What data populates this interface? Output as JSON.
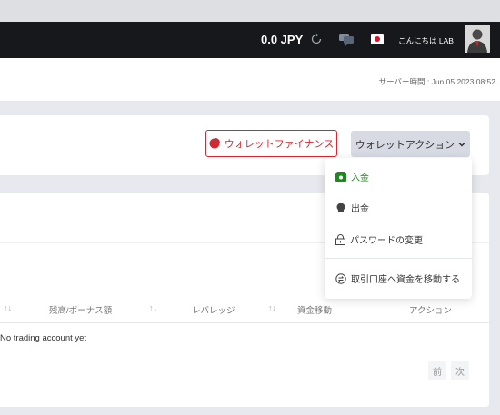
{
  "header": {
    "balance": "0.0 JPY",
    "greeting": "こんにちは LAB"
  },
  "server_time": "サーバー時間 : Jun 05 2023 08:52",
  "actions": {
    "finance_label": "ウォレットファイナンス",
    "wallet_action_label": "ウォレットアクション"
  },
  "menu": {
    "deposit": "入金",
    "withdraw": "出金",
    "change_password": "パスワードの変更",
    "transfer": "取引口座へ資金を移動する"
  },
  "table": {
    "headers": [
      "残高/ボーナス額",
      "レバレッジ",
      "資金移動",
      "アクション"
    ],
    "empty_text": "No trading account yet"
  },
  "pagination": {
    "prev": "前",
    "next": "次"
  },
  "colors": {
    "accent_red": "#d9262e",
    "deposit_green": "#1a8a1a",
    "topbar": "#17181c"
  }
}
